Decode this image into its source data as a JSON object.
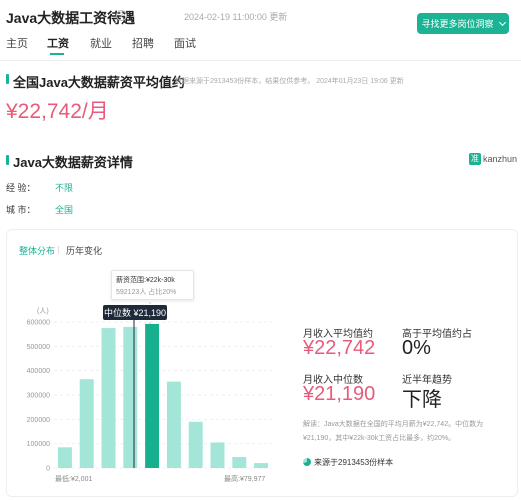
{
  "header": {
    "title": "Java大数据工资待遇",
    "update_time": "2024-02-19 11:00:00 更新",
    "cta_label": "寻找更多岗位洞察"
  },
  "nav": {
    "tabs": [
      "主页",
      "工资",
      "就业",
      "招聘",
      "面试"
    ],
    "active": "工资"
  },
  "avg_section": {
    "heading": "全国Java大数据薪资平均值约",
    "note": "数据来源于2913453份样本，结果仅供参考。  2024年01月23日 19:06 更新",
    "salary": "¥22,742/月"
  },
  "detail_section": {
    "heading": "Java大数据薪资详情",
    "logo_text": "kanzhun",
    "logo_glyph": "准",
    "experience_label": "经      验：",
    "experience_value": "不限",
    "city_label": "城      市：",
    "city_value": "全国"
  },
  "card": {
    "tab_overall": "整体分布",
    "tab_history": "历年变化",
    "tooltip_title": "薪资范围:¥22k-30k",
    "tooltip_detail": "592123人   占比20%",
    "median_badge": "中位数 ¥21,190",
    "stats": {
      "avg_label": "月收入平均值约",
      "avg_value": "¥22,742",
      "above_label": "高于平均值约占",
      "above_value": "0%",
      "median_label": "月收入中位数",
      "median_value": "¥21,190",
      "trend_label": "近半年趋势",
      "trend_value": "下降"
    },
    "explanation": "解读：Java大数据在全国的平均月薪为¥22,742。中位数为¥21,190，其中¥22k-30k工资占比最多，约20%。",
    "source": "来源于2913453份样本"
  },
  "chart_data": {
    "type": "bar",
    "ylabel": "(人)",
    "yticks": [
      "600000",
      "500000",
      "400000",
      "300000",
      "200000",
      "100000",
      "0"
    ],
    "ylim": [
      0,
      600000
    ],
    "xlabel_left": "最低:¥2,001",
    "xlabel_right": "最高:¥79,977",
    "values": [
      85000,
      365000,
      575000,
      580000,
      592123,
      355000,
      190000,
      105000,
      45000,
      20000
    ],
    "highlight_index": 4,
    "bar_color": "#a3e5d6",
    "highlight_color": "#17b08f",
    "grid": true
  }
}
